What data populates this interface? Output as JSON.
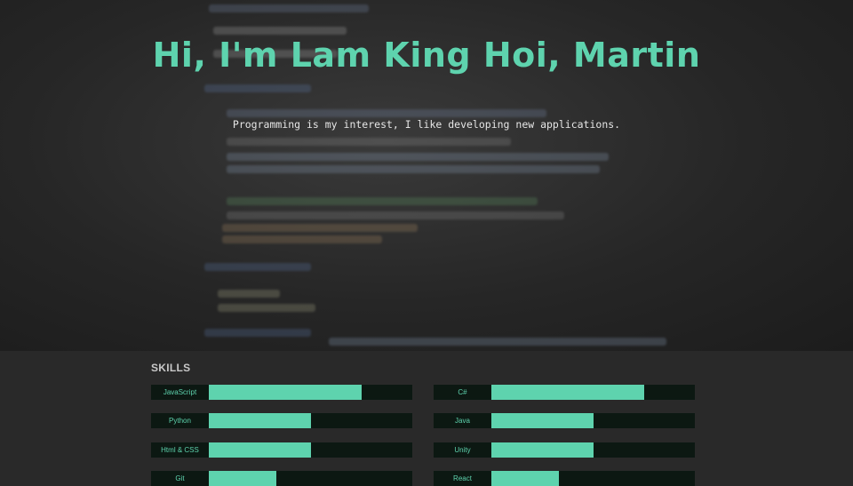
{
  "hero": {
    "title": "Hi, I'm Lam King Hoi, Martin",
    "subtitle": "Programming is my interest, I like developing new applications."
  },
  "skills": {
    "heading": "SKILLS",
    "items": [
      {
        "name": "JavaScript",
        "level": 0.75
      },
      {
        "name": "C#",
        "level": 0.75
      },
      {
        "name": "Python",
        "level": 0.5
      },
      {
        "name": "Java",
        "level": 0.5
      },
      {
        "name": "Html & CSS",
        "level": 0.5
      },
      {
        "name": "Unity",
        "level": 0.5
      },
      {
        "name": "Git",
        "level": 0.33
      },
      {
        "name": "React",
        "level": 0.33
      }
    ]
  },
  "colors": {
    "accent": "#5ed3ae",
    "bar_track": "#0c1812",
    "section_bg": "#292929"
  }
}
